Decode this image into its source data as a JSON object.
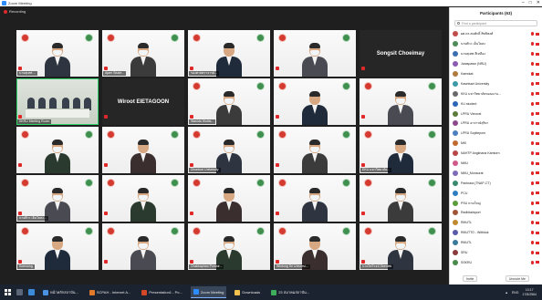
{
  "titlebar": {
    "title": "Zoom Meeting",
    "minimize": "–",
    "maximize": "□",
    "close": "✕"
  },
  "recording": {
    "label": "Recording"
  },
  "tiles": [
    {
      "name": "นายสุเทพ ..."
    },
    {
      "name": "Ajarn Stude..."
    },
    {
      "name": "รองศาสตราจารย์..."
    },
    {
      "name": ""
    },
    {
      "name": "",
      "bigname": "Songsit Choeimay"
    },
    {
      "name": "SKRU Meeting Room"
    },
    {
      "name": "",
      "bigname": "Wiroot EIETAGOON"
    },
    {
      "name": "Wanida Wuttis..."
    },
    {
      "name": ""
    },
    {
      "name": ""
    },
    {
      "name": ""
    },
    {
      "name": ""
    },
    {
      "name": "Dhonburi University"
    },
    {
      "name": ""
    },
    {
      "name": "EKU มหาวิทยาลัย..."
    },
    {
      "name": "นายศิวะ เย็นไธสง..."
    },
    {
      "name": ""
    },
    {
      "name": ""
    },
    {
      "name": ""
    },
    {
      "name": ""
    },
    {
      "name": "Somsong"
    },
    {
      "name": ""
    },
    {
      "name": "Chakkaphan Pornsir..."
    },
    {
      "name": "Wintong Sri Universi..."
    },
    {
      "name": "นายไพโรจน์ Seenlek"
    }
  ],
  "participants_panel": {
    "title": "Participants (63)",
    "find_placeholder": "Find a participant",
    "invite_label": "Invite",
    "mute_all_label": "Unmute Me",
    "items": [
      {
        "name": "ผศ.ดร.สมศักดิ์ สิทธิพงศ์",
        "avatar_color": "#c04c4c"
      },
      {
        "name": "นายศิวะ เย็นไธสง",
        "avatar_color": "#4f8a5b"
      },
      {
        "name": "นายสุเทพ สีเหลือง",
        "avatar_color": "#3d6fb0"
      },
      {
        "name": "Jaraspawn (NRU)",
        "avatar_color": "#8a5bb0"
      },
      {
        "name": "Kaewkat",
        "avatar_color": "#b07a3d"
      },
      {
        "name": "Kasetsart University",
        "avatar_color": "#3d9aa8"
      },
      {
        "name": "KKU มหาวิทยาลัยขอนแก่น...",
        "avatar_color": "#6a6a6a"
      },
      {
        "name": "KU student",
        "avatar_color": "#2e66b8"
      },
      {
        "name": "LPRU Vimorat",
        "avatar_color": "#5a7d3b"
      },
      {
        "name": "LPRU อาจารย์สุริยา",
        "avatar_color": "#8c4a8c"
      },
      {
        "name": "LPRU Sopiteporn",
        "avatar_color": "#4c7fbf"
      },
      {
        "name": "MKI",
        "avatar_color": "#c06a30"
      },
      {
        "name": "NAHTP Angkhana Kamtorn",
        "avatar_color": "#b84646"
      },
      {
        "name": "NMU",
        "avatar_color": "#d05a8a"
      },
      {
        "name": "NMU_Monsorat",
        "avatar_color": "#7e6bb8"
      },
      {
        "name": "Pantnara (TNAP-CT)",
        "avatar_color": "#3a8a70"
      },
      {
        "name": "PCU",
        "avatar_color": "#2f7fc0"
      },
      {
        "name": "PSU หาดใหญ่",
        "avatar_color": "#5c9c3a"
      },
      {
        "name": "Radhitaksport",
        "avatar_color": "#a0553a"
      },
      {
        "name": "RMUTL",
        "avatar_color": "#c08a2f"
      },
      {
        "name": "RMUTTO - Wittiduk",
        "avatar_color": "#5a5aa8"
      },
      {
        "name": "RMUTL",
        "avatar_color": "#3a7a9a"
      },
      {
        "name": "SRU",
        "avatar_color": "#8a3a3a"
      },
      {
        "name": "SSKRU",
        "avatar_color": "#4a8a4a"
      }
    ]
  },
  "taskbar": {
    "apps": [
      {
        "label": "หน้าหลักสถาบัน...",
        "color": "#4a90e2",
        "active": false
      },
      {
        "label": "SCPAH - Internet A...",
        "color": "#e07a2a",
        "active": false
      },
      {
        "label": "Presentation1 - Po...",
        "color": "#d24726",
        "active": false
      },
      {
        "label": "Zoom Meeting",
        "color": "#2d8cff",
        "active": true
      },
      {
        "label": "Downloads",
        "color": "#f2c14e",
        "active": false
      },
      {
        "label": "23 สมาคมสถาบัน...",
        "color": "#3fae5a",
        "active": false
      }
    ],
    "lang": "ENG",
    "time": "13:17",
    "date": "17/5/2564"
  }
}
